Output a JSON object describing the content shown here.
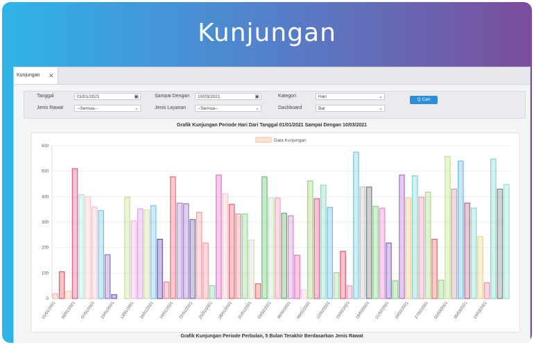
{
  "banner": {
    "title": "Kunjungan"
  },
  "tab": {
    "label": "Kunjungan",
    "close": "✕"
  },
  "filters": {
    "tanggal_label": "Tanggal",
    "tanggal_value": "01/01/2021",
    "sampai_label": "Sampai Dengan",
    "sampai_value": "10/03/2021",
    "kategori_label": "Kategori",
    "kategori_value": "Hari",
    "jenis_rawat_label": "Jenis Rawat",
    "jenis_rawat_value": "--Semua--",
    "jenis_layanan_label": "Jenis Layanan",
    "jenis_layanan_value": "--Semua--",
    "dashboard_label": "Dashboard",
    "dashboard_value": "Bar",
    "search_label": "Q Cari"
  },
  "chart_title": "Grafik Kunjungan Periode Hari Dari Tanggal 01/01/2021 Sampai Dengan 10/03/2021",
  "bottom_title": "Grafik Kunjungan Periode Perbulan, 5 Bulan Terakhir Berdasarkan Jenis Rawat",
  "chart_data": {
    "type": "bar",
    "legend": "Data Kunjungan",
    "ylim": [
      0,
      600
    ],
    "yticks": [
      0,
      100,
      200,
      300,
      400,
      500,
      600
    ],
    "xticks": [
      "01/01/2021",
      "04/01/2021",
      "07/01/2021",
      "10/01/2021",
      "13/01/2021",
      "16/01/2021",
      "19/01/2021",
      "22/01/2021",
      "25/01/2021",
      "28/01/2021",
      "31/01/2021",
      "03/02/2021",
      "06/02/2021",
      "09/02/2021",
      "12/02/2021",
      "15/02/2021",
      "18/02/2021",
      "21/02/2021",
      "24/02/2021",
      "27/02/2021",
      "02/03/2021",
      "05/03/2021",
      "10/03/2021"
    ],
    "values": [
      18,
      105,
      28,
      510,
      408,
      400,
      360,
      345,
      172,
      15,
      0,
      398,
      305,
      352,
      348,
      365,
      233,
      65,
      478,
      375,
      372,
      310,
      338,
      218,
      50,
      485,
      412,
      370,
      332,
      332,
      230,
      58,
      478,
      395,
      395,
      335,
      325,
      170,
      35,
      462,
      392,
      445,
      358,
      102,
      185,
      50,
      575,
      438,
      438,
      362,
      355,
      218,
      70,
      485,
      395,
      482,
      398,
      418,
      233,
      72,
      558,
      430,
      540,
      375,
      355,
      243,
      62,
      548,
      430,
      448
    ],
    "colors": [
      "#f4b59c",
      "#e9545a",
      "#fbd0b0",
      "#e05a85",
      "#a9e4dc",
      "#f9c9cd",
      "#f4c4c4",
      "#6cc3e7",
      "#8e73c4",
      "#6b5ab8",
      "#ffffff",
      "#c5e08e",
      "#f3b3e2",
      "#d9a1e3",
      "#cfe2a0",
      "#6cc3e7",
      "#6a4fae",
      "#f08090",
      "#f16a6e",
      "#a98ad1",
      "#9f7cc7",
      "#7a66b0",
      "#f39aa0",
      "#f39aa0",
      "#86d6a9",
      "#e86ad5",
      "#f5c6c6",
      "#e06070",
      "#e08e9a",
      "#8fd88a",
      "#d8d6c6",
      "#ea6e6e",
      "#66c46a",
      "#b9e6bf",
      "#f39fba",
      "#66aa60",
      "#c88bd1",
      "#e871b8",
      "#fad0d8",
      "#98d87a",
      "#e25e8a",
      "#8ad6c6",
      "#6cb9ea",
      "#9fd89a",
      "#e2586a",
      "#e898c4",
      "#6cc9ef",
      "#bfbfbf",
      "#7a7a80",
      "#80d67a",
      "#e887d2",
      "#8a62c4",
      "#80d67a",
      "#b56ad6",
      "#f8c58c",
      "#7ad6d1",
      "#f39ab0",
      "#a8d78a",
      "#e56a6a",
      "#98d88a",
      "#b9e57d",
      "#c2a4a0",
      "#6cb8e8",
      "#b56a8a",
      "#88d4cc",
      "#e6d48a",
      "#f88ab0",
      "#80d6cc",
      "#7a8080",
      "#98e0d4"
    ]
  }
}
